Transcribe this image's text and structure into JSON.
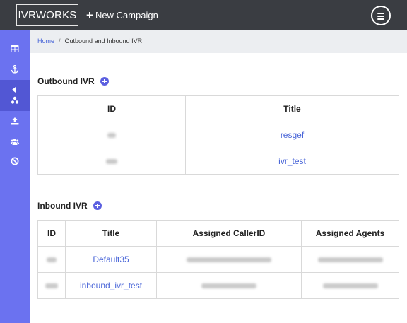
{
  "header": {
    "brand": "IVRWORKS",
    "new_campaign_label": "New Campaign",
    "new_campaign_icon": "plus-icon",
    "menu_icon": "hamburger-circle-icon",
    "background": "#3a3d42"
  },
  "sidebar": {
    "background": "#6b72f0",
    "items": [
      {
        "icon": "table-icon"
      },
      {
        "icon": "anchor-icon"
      },
      {
        "icon": "sitemap-icon",
        "active": true
      },
      {
        "icon": "upload-icon"
      },
      {
        "icon": "users-icon"
      },
      {
        "icon": "ban-icon"
      }
    ]
  },
  "breadcrumb": {
    "home": "Home",
    "separator": "/",
    "current": "Outbound and Inbound IVR"
  },
  "outbound": {
    "title": "Outbound IVR",
    "columns": [
      "ID",
      "Title"
    ],
    "rows": [
      {
        "title": "resgef"
      },
      {
        "title": "ivr_test"
      }
    ]
  },
  "inbound": {
    "title": "Inbound IVR",
    "columns": [
      "ID",
      "Title",
      "Assigned CallerID",
      "Assigned Agents"
    ],
    "rows": [
      {
        "title": "Default35"
      },
      {
        "title": "inbound_ivr_test"
      }
    ]
  },
  "colors": {
    "accent": "#5b5fe0",
    "link": "#4a66d8"
  }
}
